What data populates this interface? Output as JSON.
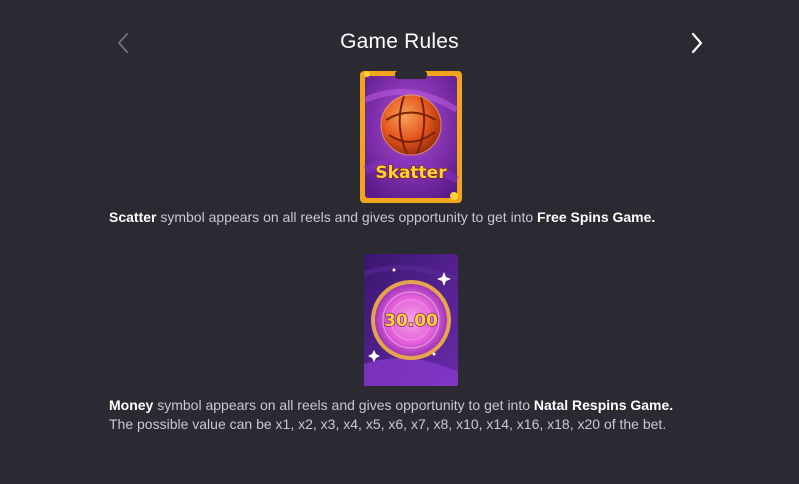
{
  "header": {
    "title": "Game Rules",
    "prev_icon": "chevron-left-icon",
    "next_icon": "chevron-right-icon"
  },
  "symbols": [
    {
      "name": "scatter",
      "image_label": "Skatter",
      "desc_bold": "Scatter",
      "desc_text": " symbol appears on all reels and gives opportunity to get into ",
      "desc_game": "Free Spins Game.",
      "colors": {
        "frame": "#f2a51c",
        "card": "#7a2ca5",
        "ball": "#e4571e"
      }
    },
    {
      "name": "money",
      "image_value": "30.00",
      "desc_bold": "Money",
      "desc_text": " symbol appears on all reels and gives opportunity to get into ",
      "desc_game": "Natal Respins Game.",
      "desc_line2": "The possible value can be x1, x2, x3, x4, x5, x6, x7, x8, x10, x14, x16, x18, x20 of the bet.",
      "colors": {
        "card": "#4b1b83",
        "disc": "#e25fd8",
        "value": "#ffd23a"
      }
    }
  ],
  "colors": {
    "background": "#2b2a32",
    "text": "#c9c8d0",
    "emphasis": "#ffffff",
    "prev_disabled": "#6f6e76"
  }
}
